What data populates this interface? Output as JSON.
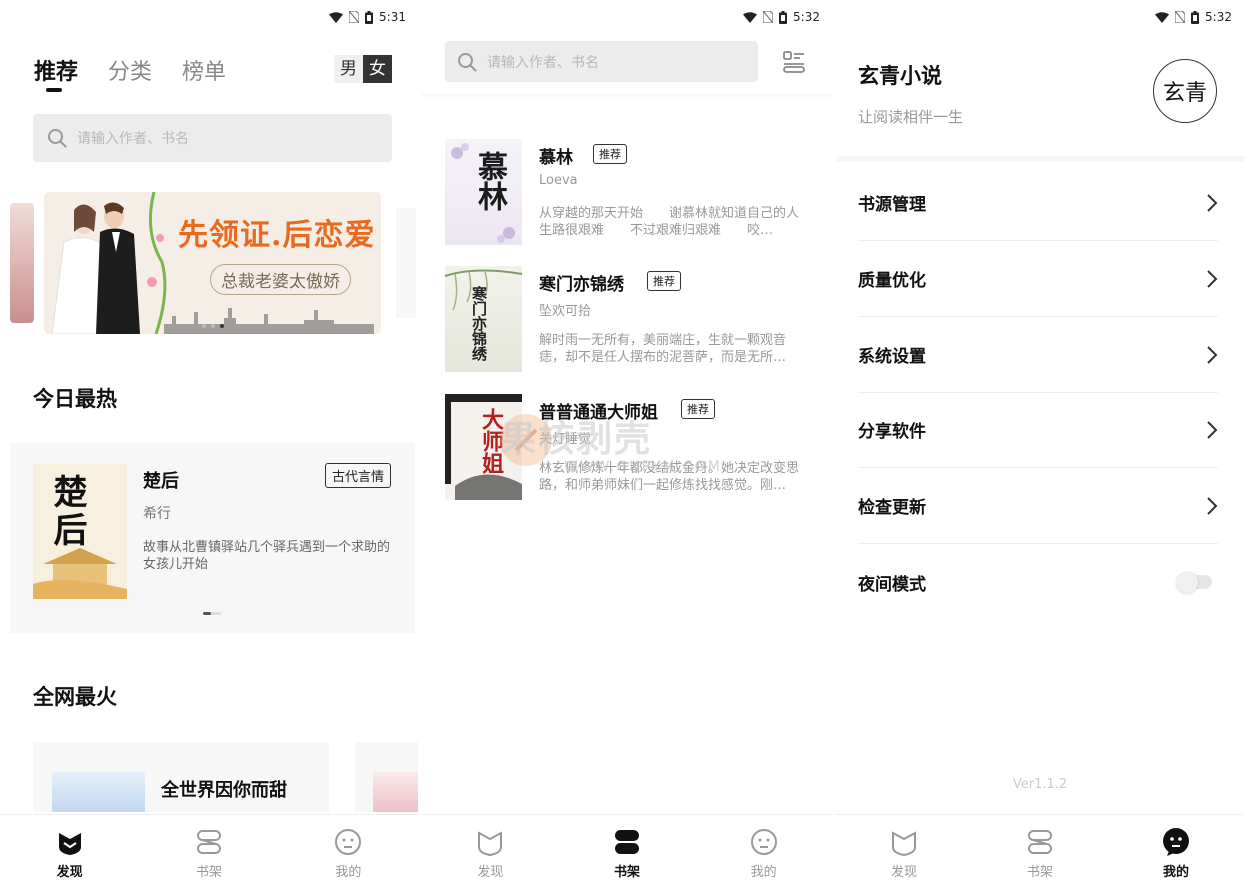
{
  "status_bars": [
    {
      "time": "5:31"
    },
    {
      "time": "5:32"
    },
    {
      "time": "5:32"
    }
  ],
  "discover": {
    "tabs": [
      {
        "label": "推荐",
        "active": true
      },
      {
        "label": "分类",
        "active": false
      },
      {
        "label": "榜单",
        "active": false
      }
    ],
    "gender": {
      "male": "男",
      "female": "女",
      "selected": "女"
    },
    "search_placeholder": "请输入作者、书名",
    "banner": {
      "title": "先领证.后恋爱",
      "subtitle": "总裁老婆太傲娇",
      "page_count": 3,
      "active_page": 3
    },
    "hot_today": {
      "heading": "今日最热",
      "book": {
        "title": "楚后",
        "tag": "古代言情",
        "author": "希行",
        "description": "故事从北曹镇驿站几个驿兵遇到一个求助的女孩儿开始",
        "cover_text": "楚后"
      }
    },
    "net_hot": {
      "heading": "全网最火",
      "book": {
        "title": "全世界因你而甜"
      }
    }
  },
  "shelf": {
    "search_placeholder": "请输入作者、书名",
    "books": [
      {
        "title": "慕林",
        "tag": "推荐",
        "author": "Loeva",
        "description": "从穿越的那天开始　　谢慕林就知道自己的人生路很艰难　　不过艰难归艰难　　咬…",
        "cover_text": "慕林"
      },
      {
        "title": "寒门亦锦绣",
        "tag": "推荐",
        "author": "坠欢可拾",
        "description": "解时雨一无所有，美丽端庄，生就一颗观音痣，却不是任人摆布的泥菩萨，而是无所…",
        "cover_text": "寒门亦锦绣"
      },
      {
        "title": "普普通通大师姐",
        "tag": "推荐",
        "author": "关灯睡觉",
        "description": "林玄佩修炼十年都没结成金丹。她决定改变思路，和师弟师妹们一起修炼找找感觉。刚…",
        "cover_text": "大师姐"
      }
    ],
    "watermark": {
      "text": "果核剥壳",
      "url": "WWW.GHPYM.COM"
    }
  },
  "mine": {
    "app_name": "玄青小说",
    "slogan": "让阅读相伴一生",
    "logo_text": "玄青",
    "menu": [
      {
        "label": "书源管理",
        "type": "link"
      },
      {
        "label": "质量优化",
        "type": "link"
      },
      {
        "label": "系统设置",
        "type": "link"
      },
      {
        "label": "分享软件",
        "type": "link"
      },
      {
        "label": "检查更新",
        "type": "link"
      },
      {
        "label": "夜间模式",
        "type": "toggle",
        "value": false
      }
    ],
    "version": "Ver1.1.2"
  },
  "bottom_nav": [
    {
      "label": "发现",
      "icon": "discover-icon"
    },
    {
      "label": "书架",
      "icon": "bookshelf-icon"
    },
    {
      "label": "我的",
      "icon": "profile-face-icon"
    }
  ],
  "bottom_nav_active": [
    "发现",
    "书架",
    "我的"
  ]
}
